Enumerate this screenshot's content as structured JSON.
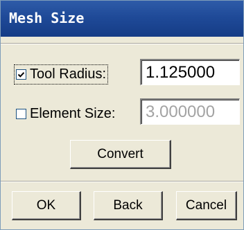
{
  "window": {
    "title": "Mesh Size",
    "title_icon": "mesh-app-icon"
  },
  "tool_radius": {
    "label": "Tool Radius:",
    "checked": true,
    "value": "1.125000"
  },
  "element_size": {
    "label": "Element Size:",
    "checked": false,
    "value": "3.000000"
  },
  "buttons": {
    "convert": "Convert",
    "ok": "OK",
    "back": "Back",
    "cancel": "Cancel"
  }
}
